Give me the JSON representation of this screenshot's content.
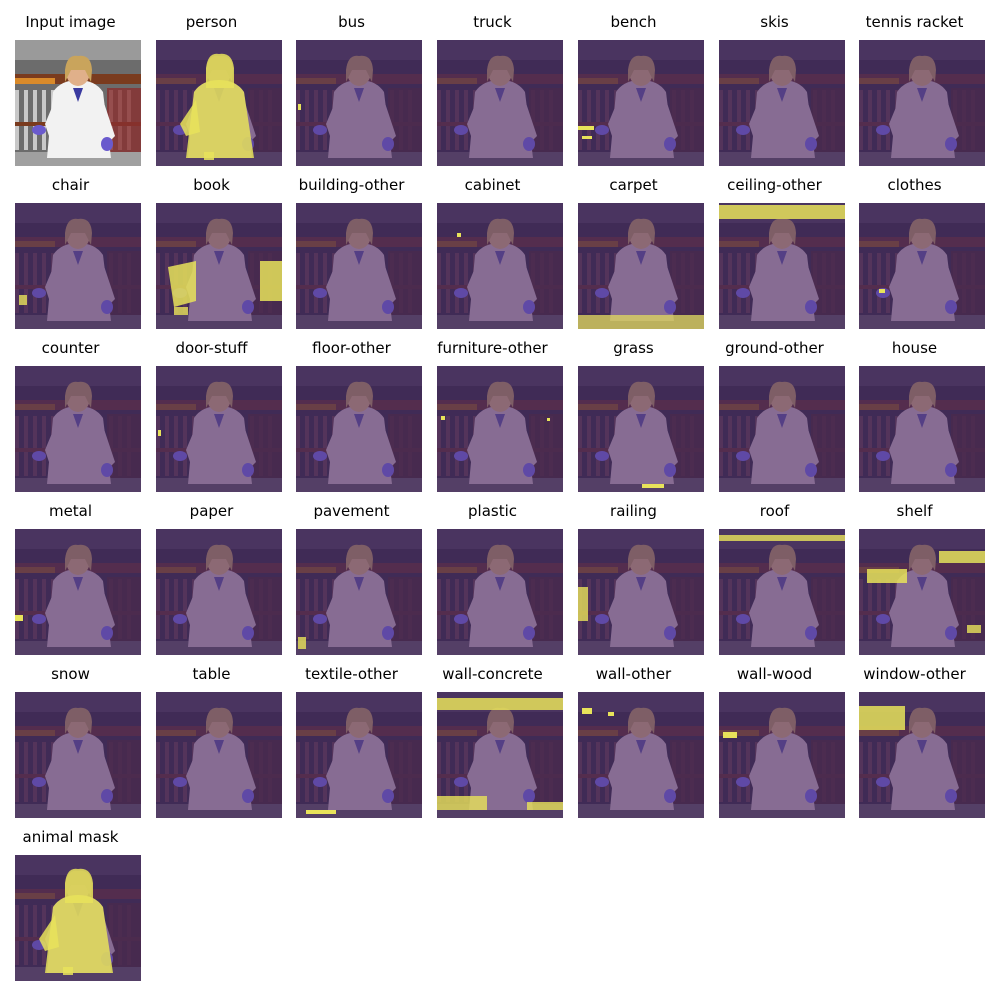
{
  "panels": [
    {
      "title": "Input image",
      "kind": "input"
    },
    {
      "title": "person",
      "kind": "mask",
      "mask": "person"
    },
    {
      "title": "bus",
      "kind": "mask",
      "mask": "speck-left"
    },
    {
      "title": "truck",
      "kind": "mask",
      "mask": "none"
    },
    {
      "title": "bench",
      "kind": "mask",
      "mask": "bench"
    },
    {
      "title": "skis",
      "kind": "mask",
      "mask": "none"
    },
    {
      "title": "tennis racket",
      "kind": "mask",
      "mask": "none"
    },
    {
      "title": "chair",
      "kind": "mask",
      "mask": "chair"
    },
    {
      "title": "book",
      "kind": "mask",
      "mask": "book"
    },
    {
      "title": "building-other",
      "kind": "mask",
      "mask": "none"
    },
    {
      "title": "cabinet",
      "kind": "mask",
      "mask": "speck-mid"
    },
    {
      "title": "carpet",
      "kind": "mask",
      "mask": "carpet"
    },
    {
      "title": "ceiling-other",
      "kind": "mask",
      "mask": "ceiling"
    },
    {
      "title": "clothes",
      "kind": "mask",
      "mask": "speck-hand"
    },
    {
      "title": "counter",
      "kind": "mask",
      "mask": "none"
    },
    {
      "title": "door-stuff",
      "kind": "mask",
      "mask": "speck-left"
    },
    {
      "title": "floor-other",
      "kind": "mask",
      "mask": "none"
    },
    {
      "title": "furniture-other",
      "kind": "mask",
      "mask": "furniture"
    },
    {
      "title": "grass",
      "kind": "mask",
      "mask": "grass"
    },
    {
      "title": "ground-other",
      "kind": "mask",
      "mask": "none"
    },
    {
      "title": "house",
      "kind": "mask",
      "mask": "none"
    },
    {
      "title": "metal",
      "kind": "mask",
      "mask": "metal"
    },
    {
      "title": "paper",
      "kind": "mask",
      "mask": "none"
    },
    {
      "title": "pavement",
      "kind": "mask",
      "mask": "pavement"
    },
    {
      "title": "plastic",
      "kind": "mask",
      "mask": "none"
    },
    {
      "title": "railing",
      "kind": "mask",
      "mask": "railing"
    },
    {
      "title": "roof",
      "kind": "mask",
      "mask": "roof"
    },
    {
      "title": "shelf",
      "kind": "mask",
      "mask": "shelf"
    },
    {
      "title": "snow",
      "kind": "mask",
      "mask": "none"
    },
    {
      "title": "table",
      "kind": "mask",
      "mask": "none"
    },
    {
      "title": "textile-other",
      "kind": "mask",
      "mask": "textile"
    },
    {
      "title": "wall-concrete",
      "kind": "mask",
      "mask": "wallconcrete"
    },
    {
      "title": "wall-other",
      "kind": "mask",
      "mask": "wallother"
    },
    {
      "title": "wall-wood",
      "kind": "mask",
      "mask": "wallwood"
    },
    {
      "title": "window-other",
      "kind": "mask",
      "mask": "window"
    },
    {
      "title": "animal mask",
      "kind": "mask",
      "mask": "person"
    }
  ],
  "colors": {
    "mask_highlight": "#e8e35a",
    "overlay_tint": "#4a2a5e",
    "glove": "#6a5acd",
    "coat": "#f2f2f2",
    "hair": "#c9a45c",
    "shelf_wood": "#7a3b1e"
  }
}
